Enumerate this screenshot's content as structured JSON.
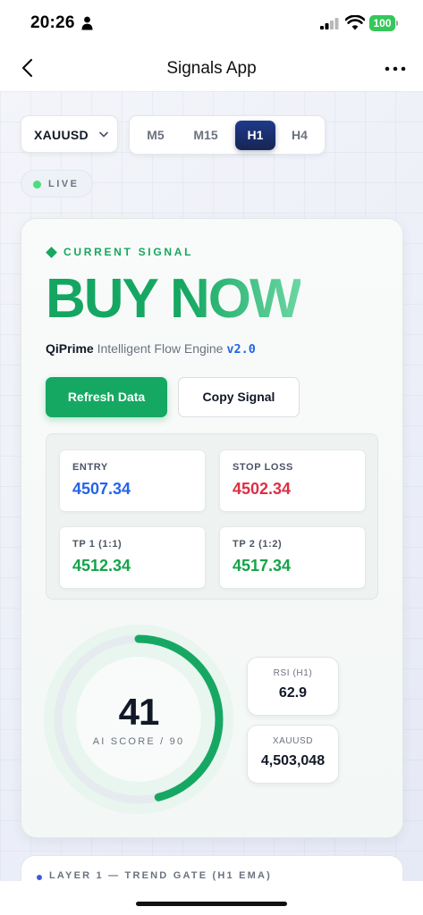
{
  "status_bar": {
    "time": "20:26",
    "battery": "100",
    "battery_color": "#34c759"
  },
  "nav": {
    "title": "Signals App",
    "back_icon": "chevron-left-icon",
    "more_icon": "more-horizontal-icon"
  },
  "controls": {
    "symbol": "XAUUSD",
    "timeframes": [
      "M5",
      "M15",
      "H1",
      "H4"
    ],
    "active_timeframe": "H1",
    "live_label": "LIVE"
  },
  "signal": {
    "eyebrow": "CURRENT SIGNAL",
    "headline": "BUY NOW",
    "engine_brand": "QiPrime",
    "engine_name": "Intelligent Flow Engine",
    "engine_version": "v2.0",
    "refresh_label": "Refresh Data",
    "copy_label": "Copy Signal",
    "accent_color": "#1aa65f"
  },
  "levels": [
    {
      "label": "ENTRY",
      "value": "4507.34",
      "color": "#2563eb"
    },
    {
      "label": "STOP LOSS",
      "value": "4502.34",
      "color": "#dc2f45"
    },
    {
      "label": "TP 1 (1:1)",
      "value": "4512.34",
      "color": "#16a34a"
    },
    {
      "label": "TP 2 (1:2)",
      "value": "4517.34",
      "color": "#16a34a"
    }
  ],
  "score": {
    "value": "41",
    "max": 90,
    "caption": "AI SCORE / 90",
    "progress_fraction": 0.46,
    "ring_color": "#16a863"
  },
  "stats": [
    {
      "label": "RSI (H1)",
      "value": "62.9"
    },
    {
      "label": "XAUUSD",
      "value": "4,503,048"
    }
  ],
  "layer": {
    "title": "LAYER 1 — TREND GATE (H1 EMA)"
  }
}
